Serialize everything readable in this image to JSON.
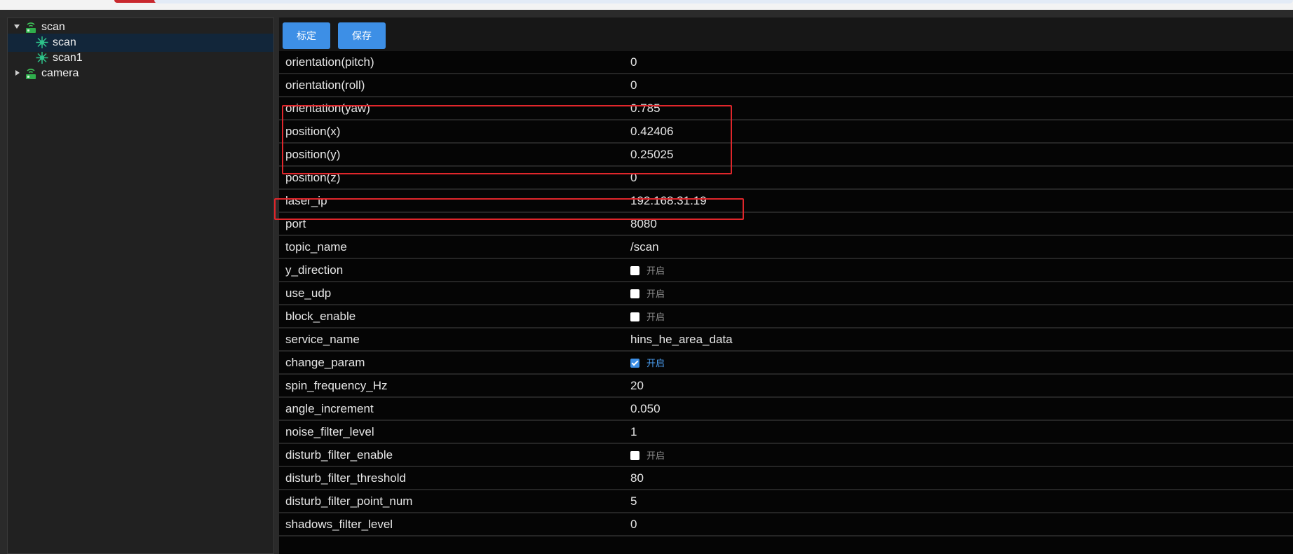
{
  "sidebar": {
    "items": [
      {
        "label": "scan",
        "icon": "router-icon",
        "expanded": true,
        "depth": 0
      },
      {
        "label": "scan",
        "icon": "laser-scan-icon",
        "selected": true,
        "depth": 1
      },
      {
        "label": "scan1",
        "icon": "laser-scan-icon",
        "depth": 1
      },
      {
        "label": "camera",
        "icon": "router-icon",
        "expanded": false,
        "depth": 0
      }
    ]
  },
  "toolbar": {
    "calibrate_label": "标定",
    "save_label": "保存"
  },
  "params": {
    "rows": [
      {
        "key": "orientation(pitch)",
        "value": "0"
      },
      {
        "key": "orientation(roll)",
        "value": "0"
      },
      {
        "key": "orientation(yaw)",
        "value": "0.785"
      },
      {
        "key": "position(x)",
        "value": "0.42406"
      },
      {
        "key": "position(y)",
        "value": "0.25025"
      },
      {
        "key": "position(z)",
        "value": "0"
      },
      {
        "key": "laser_ip",
        "value": "192.168.31.19"
      },
      {
        "key": "port",
        "value": "8080"
      },
      {
        "key": "topic_name",
        "value": "/scan"
      },
      {
        "key": "y_direction",
        "checkbox": true,
        "checked": false,
        "value": "开启"
      },
      {
        "key": "use_udp",
        "checkbox": true,
        "checked": false,
        "value": "开启"
      },
      {
        "key": "block_enable",
        "checkbox": true,
        "checked": false,
        "value": "开启"
      },
      {
        "key": "service_name",
        "value": "hins_he_area_data"
      },
      {
        "key": "change_param",
        "checkbox": true,
        "checked": true,
        "value": "开启"
      },
      {
        "key": "spin_frequency_Hz",
        "value": "20"
      },
      {
        "key": "angle_increment",
        "value": "0.050"
      },
      {
        "key": "noise_filter_level",
        "value": "1"
      },
      {
        "key": "disturb_filter_enable",
        "checkbox": true,
        "checked": false,
        "value": "开启"
      },
      {
        "key": "disturb_filter_threshold",
        "value": "80"
      },
      {
        "key": "disturb_filter_point_num",
        "value": "5"
      },
      {
        "key": "shadows_filter_level",
        "value": "0"
      }
    ]
  },
  "colors": {
    "accent": "#3d8fe6",
    "highlight": "#e0262b",
    "selected_row": "#12263a"
  }
}
